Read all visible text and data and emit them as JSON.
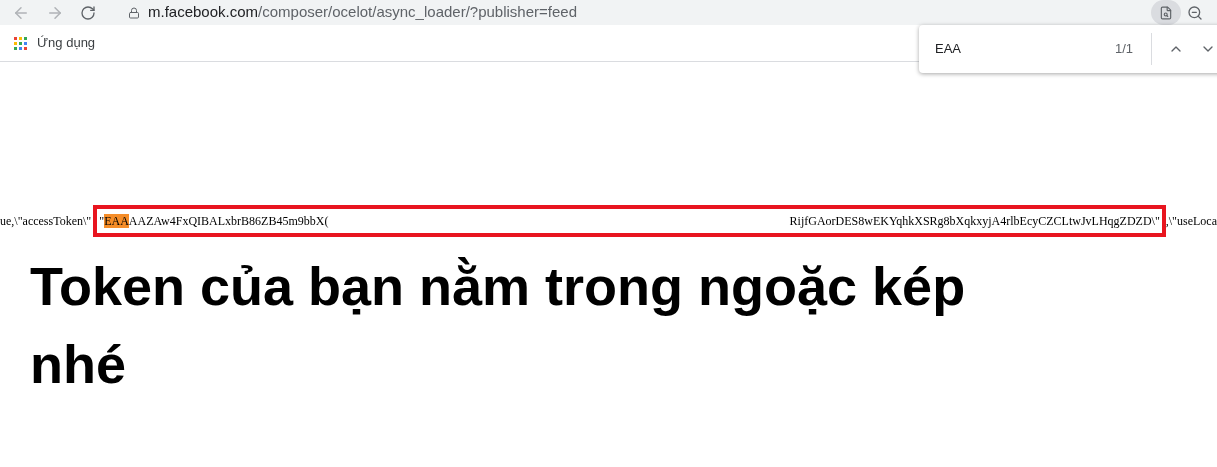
{
  "address_bar": {
    "host": "m.facebook.com",
    "path": "/composer/ocelot/async_loader/?publisher=feed"
  },
  "bookmarks": [
    {
      "label": "Ứng dụng"
    }
  ],
  "find_bar": {
    "query": "EAA",
    "count": "1/1"
  },
  "token_line": {
    "before": "ue,\\\"accessToken\\\"",
    "quote": "\"",
    "match": "EAA",
    "token_start": "AAZAw4FxQIBALxbrB86ZB45m9bbX(",
    "token_end": "RijfGAorDES8wEKYqhkXSRg8bXqkxyjA4rlbEcyCZCLtwJvLHqgZDZD\\\"",
    "after": ",\\\"useLoca"
  },
  "caption": "Token của bạn nằm trong ngoặc kép nhé"
}
